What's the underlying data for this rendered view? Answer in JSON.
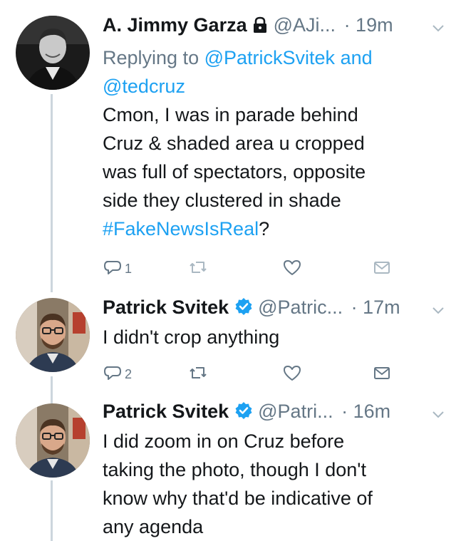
{
  "tweets": [
    {
      "name": "A. Jimmy Garza",
      "handle": "@AJi...",
      "time": "· 19m",
      "reply_prefix": "Replying to",
      "reply_to_1": "@PatrickSvitek",
      "reply_and": "and",
      "reply_to_2": "@tedcruz",
      "text_lines": [
        "Cmon, I was in parade behind",
        "Cruz & shaded area u cropped",
        "was full of spectators, opposite",
        "side they clustered in shade"
      ],
      "hashtag": "#FakeNewsIsReal",
      "hashtag_suffix": "?",
      "reply_count": "1",
      "retweet_count": "",
      "like_count": ""
    },
    {
      "name": "Patrick Svitek",
      "handle": "@Patric...",
      "time": "· 17m",
      "text_lines": [
        "I didn't crop anything"
      ],
      "reply_count": "2",
      "retweet_count": "",
      "like_count": ""
    },
    {
      "name": "Patrick Svitek",
      "handle": "@Patri...",
      "time": "· 16m",
      "text_lines": [
        "I did zoom in on Cruz before",
        "taking the photo, though I don't",
        "know why that'd be indicative of",
        "any agenda"
      ]
    }
  ],
  "colors": {
    "link": "#1da1f2",
    "muted": "#657786",
    "text": "#14171a",
    "verified": "#1da1f2",
    "thread_line": "#ccd6dd"
  },
  "icons": {
    "protected": "lock-icon",
    "verified": "verified-badge-icon",
    "menu": "chevron-down-icon",
    "reply": "reply-icon",
    "retweet": "retweet-icon",
    "like": "heart-icon",
    "dm": "envelope-icon"
  }
}
